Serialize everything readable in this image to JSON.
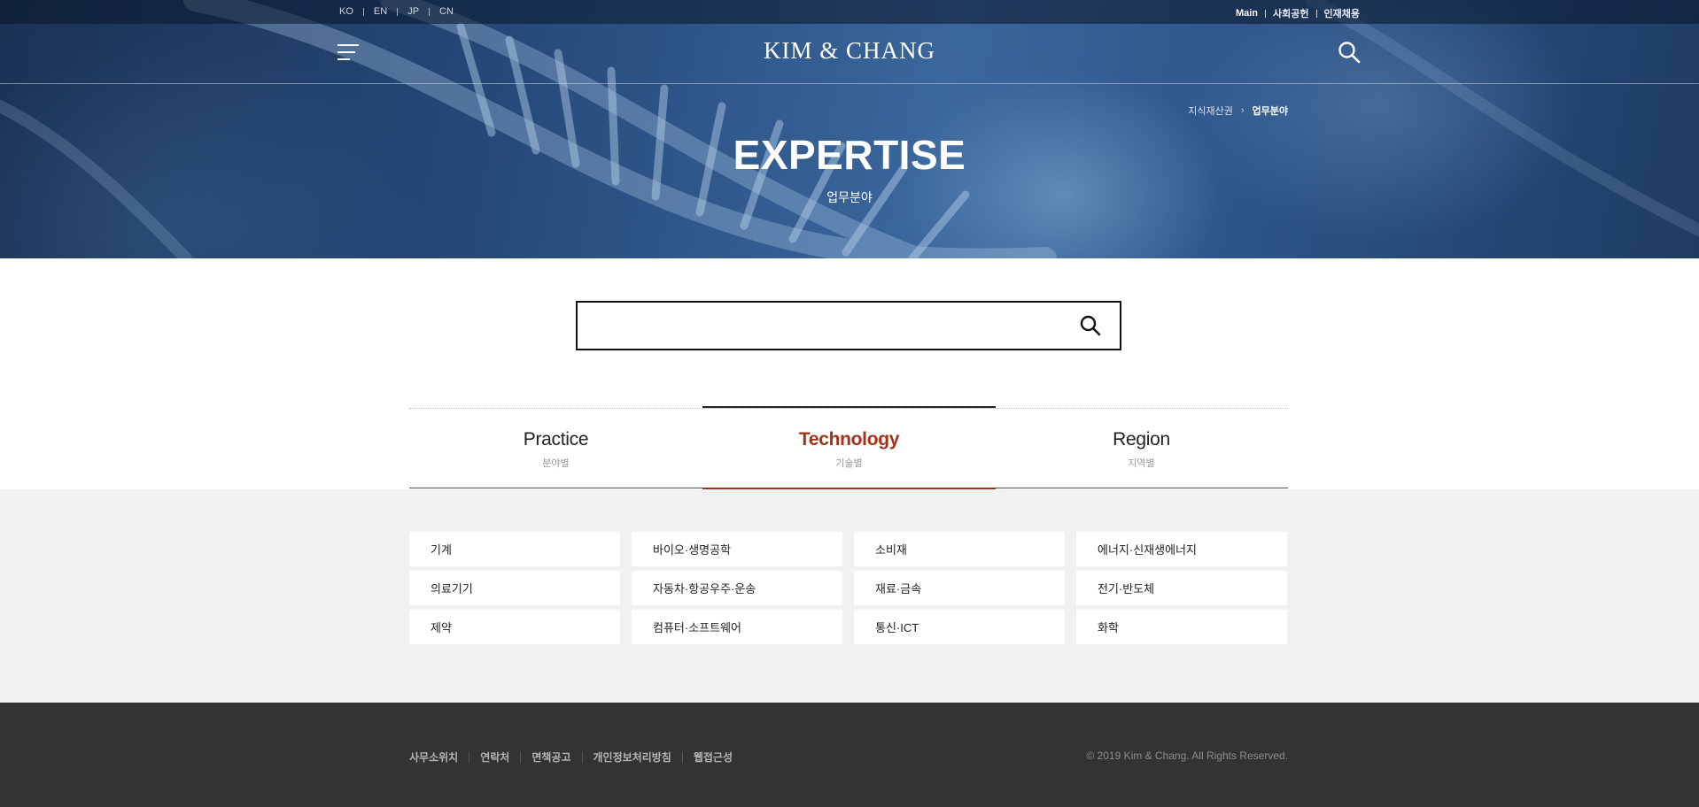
{
  "header": {
    "languages": [
      "KO",
      "EN",
      "JP",
      "CN"
    ],
    "utility_links": [
      "Main",
      "사회공헌",
      "인재채용"
    ],
    "logo": "KIM & CHANG",
    "menu_icon": "hamburger-menu-icon",
    "search_icon": "search-icon"
  },
  "hero": {
    "breadcrumb": [
      "지식재산권",
      "업무분야"
    ],
    "title": "EXPERTISE",
    "subtitle": "업무분야"
  },
  "search": {
    "placeholder": "",
    "value": "",
    "icon": "search-icon"
  },
  "tabs": [
    {
      "label": "Practice",
      "sublabel": "분야별",
      "active": false
    },
    {
      "label": "Technology",
      "sublabel": "기술별",
      "active": true
    },
    {
      "label": "Region",
      "sublabel": "지역별",
      "active": false
    }
  ],
  "categories": [
    "기계",
    "바이오·생명공학",
    "소비재",
    "에너지·신재생에너지",
    "의료기기",
    "자동차·항공우주·운송",
    "재료·금속",
    "전기·반도체",
    "제약",
    "컴퓨터·소프트웨어",
    "통신·ICT",
    "화학"
  ],
  "footer": {
    "links": [
      "사무소위치",
      "연락처",
      "면책공고",
      "개인정보처리방침",
      "웹접근성"
    ],
    "copyright": "© 2019 Kim & Chang. All Rights Reserved."
  },
  "colors": {
    "accent": "#a0341a",
    "footer_bg": "#333333",
    "content_bg": "#f1f1f1"
  }
}
